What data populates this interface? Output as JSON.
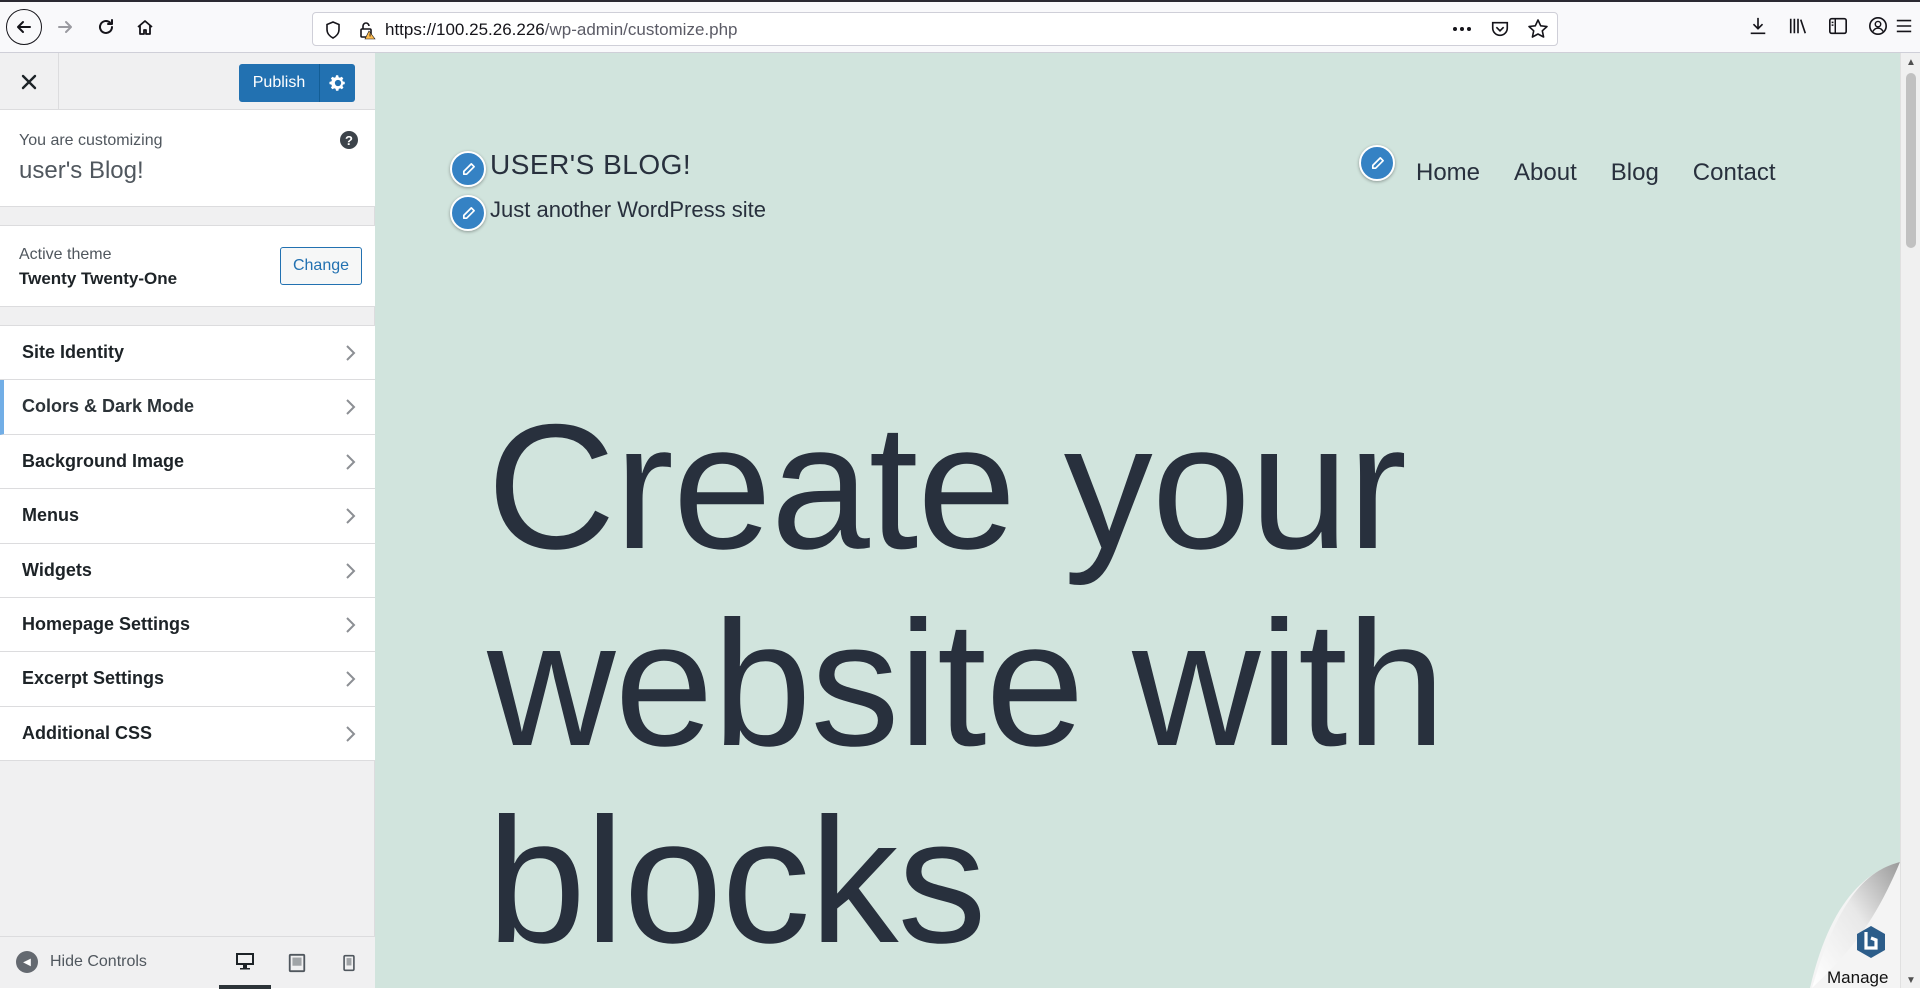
{
  "browser": {
    "url_host": "https://100.25.26.226",
    "url_path": "/wp-admin/customize.php"
  },
  "customizer": {
    "publish_label": "Publish",
    "customizing_label": "You are customizing",
    "site_name": "user's Blog!",
    "help_icon": "?",
    "active_theme_label": "Active theme",
    "active_theme_name": "Twenty Twenty-One",
    "change_label": "Change",
    "panels": [
      {
        "label": "Site Identity"
      },
      {
        "label": "Colors & Dark Mode"
      },
      {
        "label": "Background Image"
      },
      {
        "label": "Menus"
      },
      {
        "label": "Widgets"
      },
      {
        "label": "Homepage Settings"
      },
      {
        "label": "Excerpt Settings"
      },
      {
        "label": "Additional CSS"
      }
    ],
    "hide_controls_label": "Hide Controls"
  },
  "preview": {
    "site_title": "USER'S BLOG!",
    "tagline": "Just another WordPress site",
    "nav": [
      "Home",
      "About",
      "Blog",
      "Contact"
    ],
    "hero_lines": [
      "Create your",
      "website with",
      "blocks"
    ],
    "manage_label": "Manage",
    "background_color": "#d1e4dd"
  },
  "colors": {
    "accent": "#2271b1",
    "active_panel_border": "#72aee6",
    "text_dark": "#28303d"
  }
}
